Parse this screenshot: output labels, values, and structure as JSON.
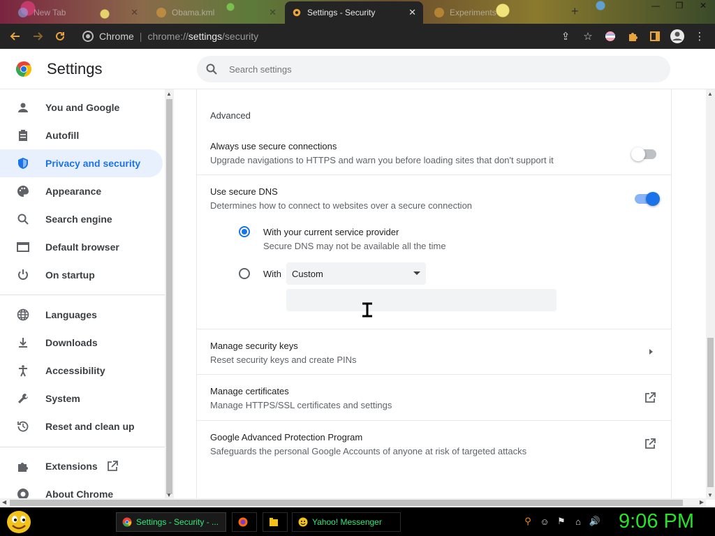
{
  "browser": {
    "tabs": [
      {
        "title": "New Tab",
        "active": false
      },
      {
        "title": "Obama.kml",
        "active": false
      },
      {
        "title": "Settings - Security",
        "active": true
      },
      {
        "title": "Experiments",
        "active": false
      }
    ],
    "omnibox": {
      "site_label": "Chrome",
      "url_prefix": "chrome://",
      "url_host": "settings",
      "url_path": "/security"
    }
  },
  "header": {
    "title": "Settings",
    "search_placeholder": "Search settings"
  },
  "sidebar": {
    "items": [
      {
        "label": "You and Google",
        "icon": "person-icon"
      },
      {
        "label": "Autofill",
        "icon": "clipboard-icon"
      },
      {
        "label": "Privacy and security",
        "icon": "shield-icon",
        "selected": true
      },
      {
        "label": "Appearance",
        "icon": "palette-icon"
      },
      {
        "label": "Search engine",
        "icon": "search-icon"
      },
      {
        "label": "Default browser",
        "icon": "browser-icon"
      },
      {
        "label": "On startup",
        "icon": "power-icon"
      },
      {
        "label": "Languages",
        "icon": "globe-icon"
      },
      {
        "label": "Downloads",
        "icon": "download-icon"
      },
      {
        "label": "Accessibility",
        "icon": "accessibility-icon"
      },
      {
        "label": "System",
        "icon": "wrench-icon"
      },
      {
        "label": "Reset and clean up",
        "icon": "reset-icon"
      },
      {
        "label": "Extensions",
        "icon": "puzzle-icon"
      },
      {
        "label": "About Chrome",
        "icon": "chrome-icon"
      }
    ]
  },
  "security": {
    "section_heading": "Advanced",
    "https_only": {
      "title": "Always use secure connections",
      "subtitle": "Upgrade navigations to HTTPS and warn you before loading sites that don't support it",
      "enabled": false
    },
    "secure_dns": {
      "title": "Use secure DNS",
      "subtitle": "Determines how to connect to websites over a secure connection",
      "enabled": true,
      "option_current": {
        "label": "With your current service provider",
        "subtitle": "Secure DNS may not be available all the time",
        "checked": true
      },
      "option_custom": {
        "label": "With",
        "checked": false
      },
      "provider_select": "Custom",
      "custom_input_value": ""
    },
    "security_keys": {
      "title": "Manage security keys",
      "subtitle": "Reset security keys and create PINs"
    },
    "certificates": {
      "title": "Manage certificates",
      "subtitle": "Manage HTTPS/SSL certificates and settings"
    },
    "advanced_protection": {
      "title": "Google Advanced Protection Program",
      "subtitle": "Safeguards the personal Google Accounts of anyone at risk of targeted attacks"
    }
  },
  "taskbar": {
    "buttons": [
      {
        "label": "Settings - Security - ...",
        "active": true
      },
      {
        "label": "",
        "active": false
      },
      {
        "label": "",
        "active": false
      },
      {
        "label": "Yahoo! Messenger",
        "active": false
      }
    ],
    "clock": "9:06 PM"
  },
  "colors": {
    "accent": "#1a73e8",
    "selected_bg": "#e8f0fe",
    "clock": "#26e22a",
    "toolbar": "#242424"
  }
}
